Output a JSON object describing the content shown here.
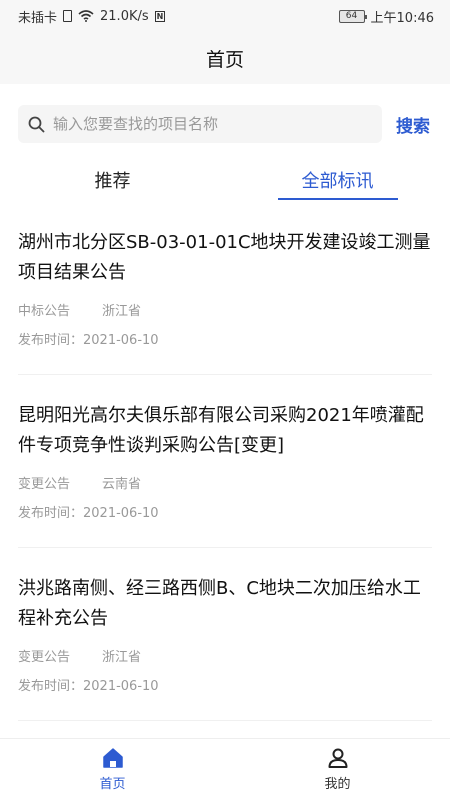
{
  "status_bar": {
    "carrier": "未插卡",
    "speed": "21.0K/s",
    "battery": "64",
    "time": "上午10:46"
  },
  "header": {
    "title": "首页"
  },
  "search": {
    "placeholder": "输入您要查找的项目名称",
    "button": "搜索"
  },
  "tabs": [
    {
      "label": "推荐",
      "active": false
    },
    {
      "label": "全部标讯",
      "active": true
    }
  ],
  "items": [
    {
      "title": "湖州市北分区SB-03-01-01C地块开发建设竣工测量项目结果公告",
      "type": "中标公告",
      "region": "浙江省",
      "date": "发布时间：2021-06-10"
    },
    {
      "title": "昆明阳光高尔夫俱乐部有限公司采购2021年喷灌配件专项竞争性谈判采购公告[变更]",
      "type": "变更公告",
      "region": "云南省",
      "date": "发布时间：2021-06-10"
    },
    {
      "title": "洪兆路南侧、经三路西侧B、C地块二次加压给水工程补充公告",
      "type": "变更公告",
      "region": "浙江省",
      "date": "发布时间：2021-06-10"
    }
  ],
  "bottom_nav": [
    {
      "label": "首页",
      "icon": "home-icon",
      "active": true
    },
    {
      "label": "我的",
      "icon": "user-icon",
      "active": false
    }
  ],
  "colors": {
    "accent": "#2d5bd1"
  }
}
